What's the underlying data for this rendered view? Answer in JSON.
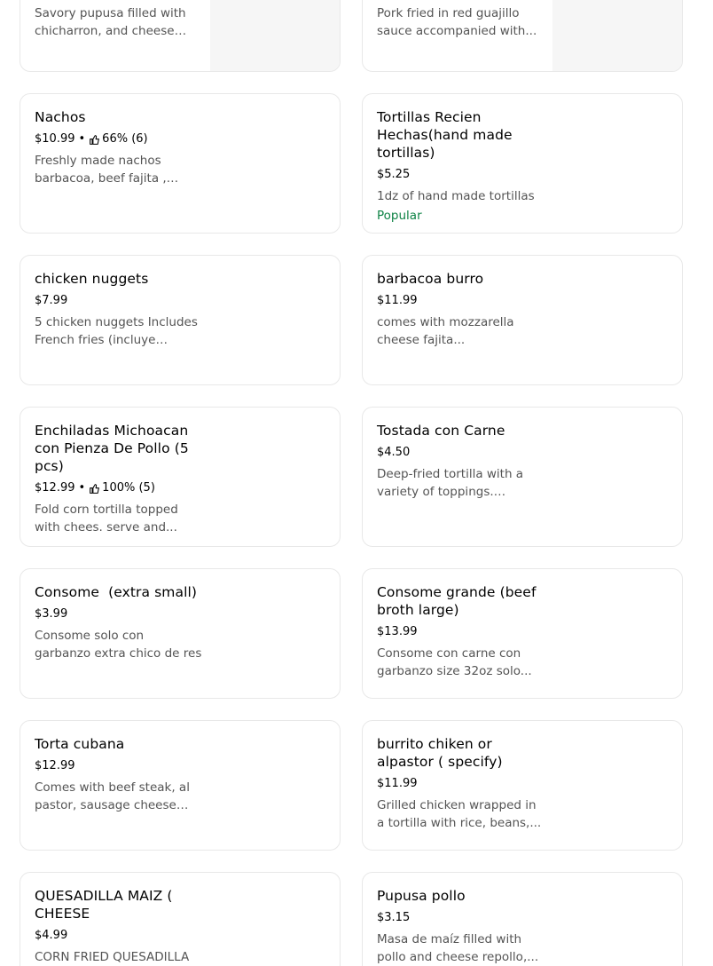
{
  "items": {
    "pupusa_chicharron": {
      "desc": "Savory pupusa filled with chicharron, and cheese on..."
    },
    "pork_guajillo": {
      "desc": "Pork fried in red guajillo sauce accompanied with..."
    },
    "nachos": {
      "title": "Nachos",
      "price": "$10.99",
      "rating": "66% (6)",
      "desc": "Freshly made nachos barbacoa, beef fajita , and..."
    },
    "tortillas": {
      "title": "Tortillas Recien Hechas(hand made tortillas)",
      "price": "$5.25",
      "desc": "1dz of hand made tortillas",
      "badge": "Popular"
    },
    "chicken_nuggets": {
      "title": "chicken nuggets",
      "price": "$7.99",
      "desc": "5 chicken nuggets Includes French fries (incluye papas..."
    },
    "barbacoa_burro": {
      "title": "barbacoa burro",
      "price": "$11.99",
      "desc": "comes with mozzarella cheese fajita..."
    },
    "enchiladas": {
      "title": "Enchiladas Michoacan con Pienza De Pollo (5 pcs)",
      "price": "$12.99",
      "rating": "100% (5)",
      "desc": "Fold corn tortilla topped with chees. serve and..."
    },
    "tostada": {
      "title": "Tostada con Carne",
      "price": "$4.50",
      "desc": "Deep-fried tortilla with a variety of toppings. Lettuc..."
    },
    "consome_small": {
      "title": "Consome  (extra small)",
      "price": "$3.99",
      "desc": "Consome solo con garbanzo extra chico de res"
    },
    "consome_grande": {
      "title": "Consome grande (beef broth large)",
      "price": "$13.99",
      "desc": "Consome con carne con garbanzo size 32oz solo..."
    },
    "torta_cubana": {
      "title": "Torta cubana",
      "price": "$12.99",
      "desc": "Comes with beef steak, al pastor, sausage cheese an..."
    },
    "burrito_chiken": {
      "title": "burrito chiken or alpastor ( specify)",
      "price": "$11.99",
      "desc": "Grilled chicken wrapped in a tortilla with rice, beans,..."
    },
    "quesadilla_maiz": {
      "title": "QUESADILLA MAIZ ( CHEESE",
      "price": "$4.99",
      "desc": "CORN FRIED QUESADILLA"
    },
    "pupusa_pollo": {
      "title": "Pupusa pollo",
      "price": "$3.15",
      "desc": "Masa de maíz filled with pollo and cheese repollo,..."
    }
  },
  "separator": "•",
  "icons": {
    "rating": "thumbs-up-icon"
  },
  "colors": {
    "popular": "#0e8345",
    "desc": "#545454",
    "border": "#e8e8e8"
  }
}
